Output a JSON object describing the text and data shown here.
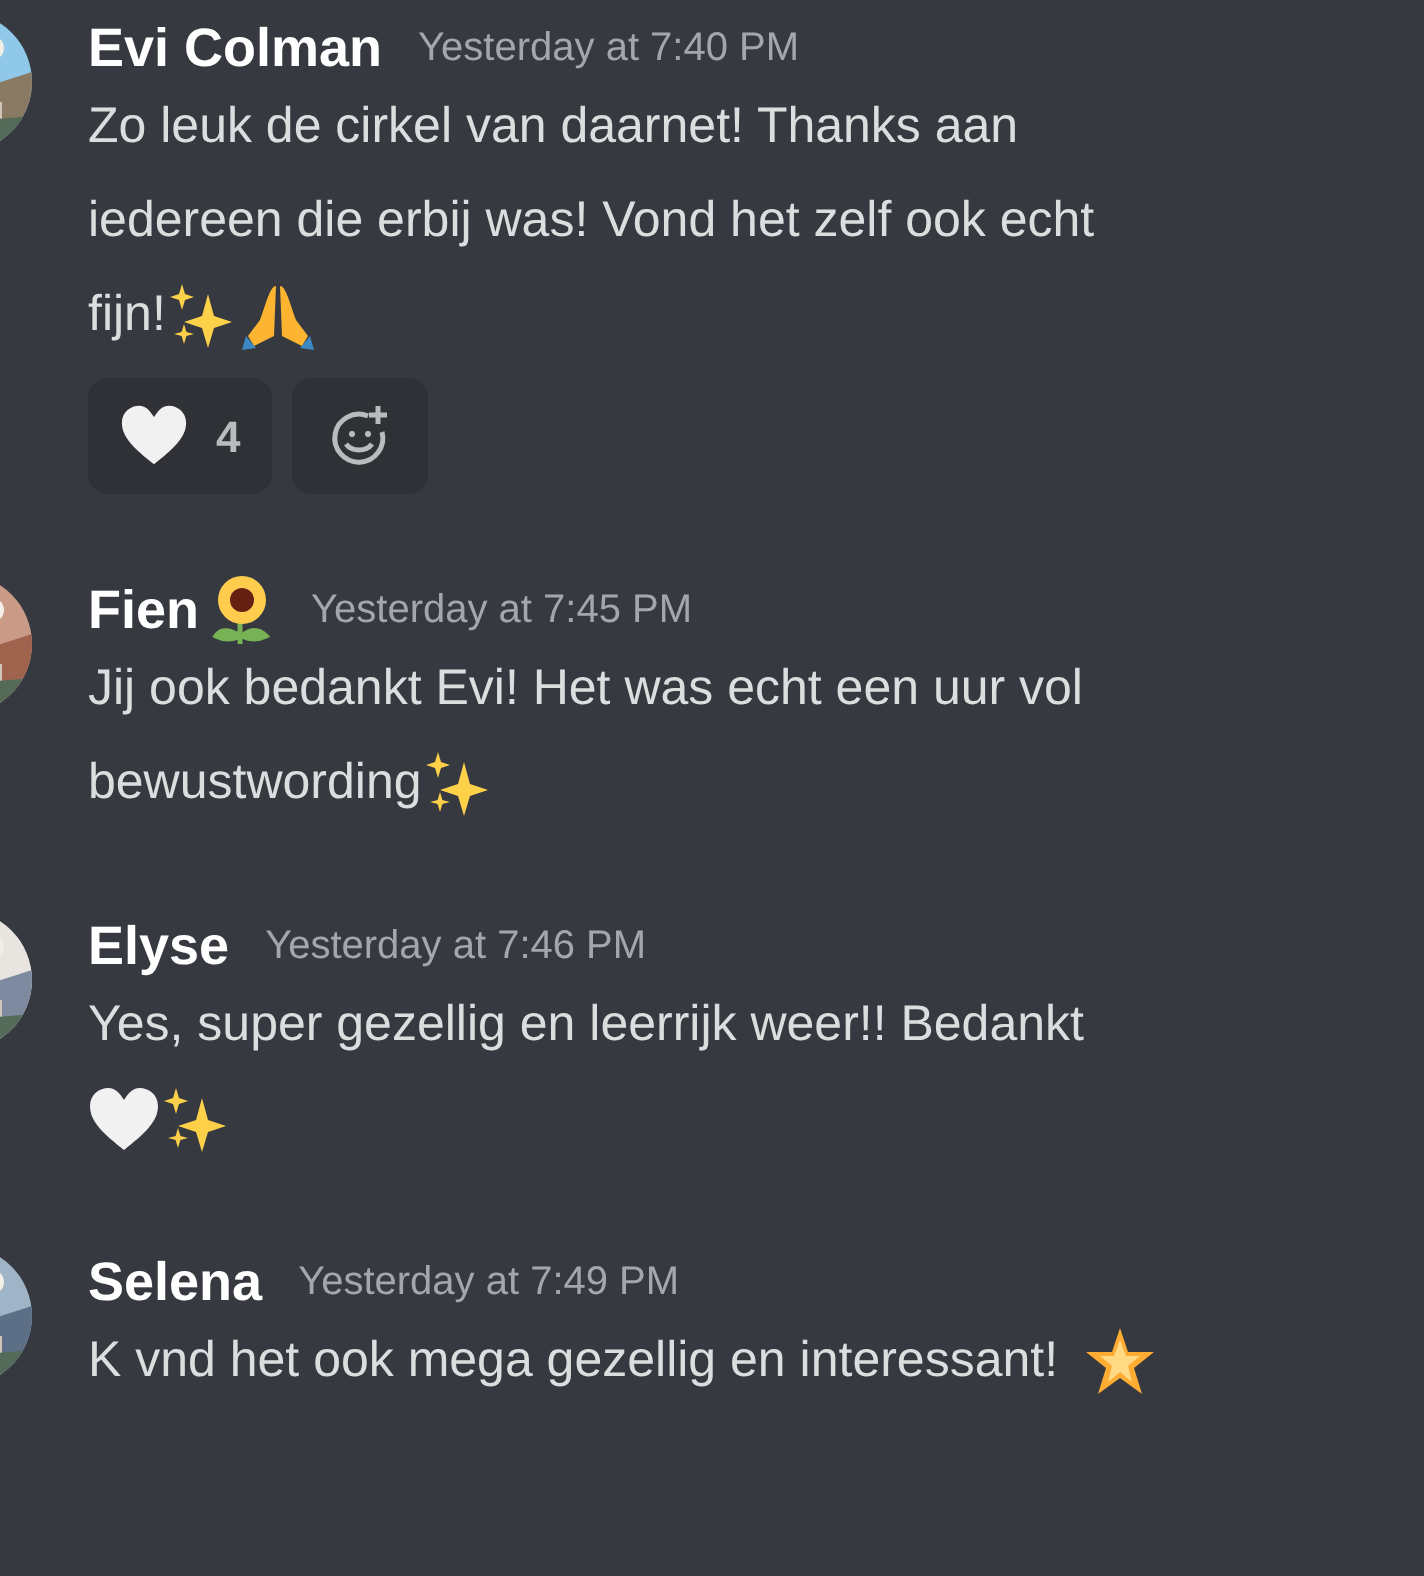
{
  "messages": [
    {
      "author": "Evi Colman",
      "time": "Yesterday at 7:40 PM",
      "lines": [
        [
          {
            "kind": "text",
            "text": "Zo leuk de cirkel van daarnet! Thanks aan"
          }
        ],
        [
          {
            "kind": "text",
            "text": "iedereen die erbij was! Vond het zelf ook echt"
          }
        ],
        [
          {
            "kind": "text",
            "text": "fijn!"
          },
          {
            "kind": "sparkles"
          },
          {
            "kind": "pray"
          }
        ]
      ],
      "reactions": [
        {
          "kind": "heart",
          "count": "4"
        },
        {
          "kind": "add"
        }
      ]
    },
    {
      "author": "Fien",
      "badges": [
        {
          "kind": "sunflower"
        }
      ],
      "time": "Yesterday at 7:45 PM",
      "lines": [
        [
          {
            "kind": "text",
            "text": "Jij ook bedankt Evi! Het was echt een uur vol"
          }
        ],
        [
          {
            "kind": "text",
            "text": "bewustwording"
          },
          {
            "kind": "sparkles"
          }
        ]
      ]
    },
    {
      "author": "Elyse",
      "time": "Yesterday at 7:46 PM",
      "lines": [
        [
          {
            "kind": "text",
            "text": "Yes, super gezellig en leerrijk weer!! Bedankt"
          }
        ],
        [
          {
            "kind": "heart"
          },
          {
            "kind": "sparkles"
          }
        ]
      ]
    },
    {
      "author": "Selena",
      "time": "Yesterday at 7:49 PM",
      "lines": [
        [
          {
            "kind": "text",
            "text": "K vnd het ook mega gezellig en interessant!"
          },
          {
            "kind": "star"
          }
        ]
      ]
    }
  ]
}
